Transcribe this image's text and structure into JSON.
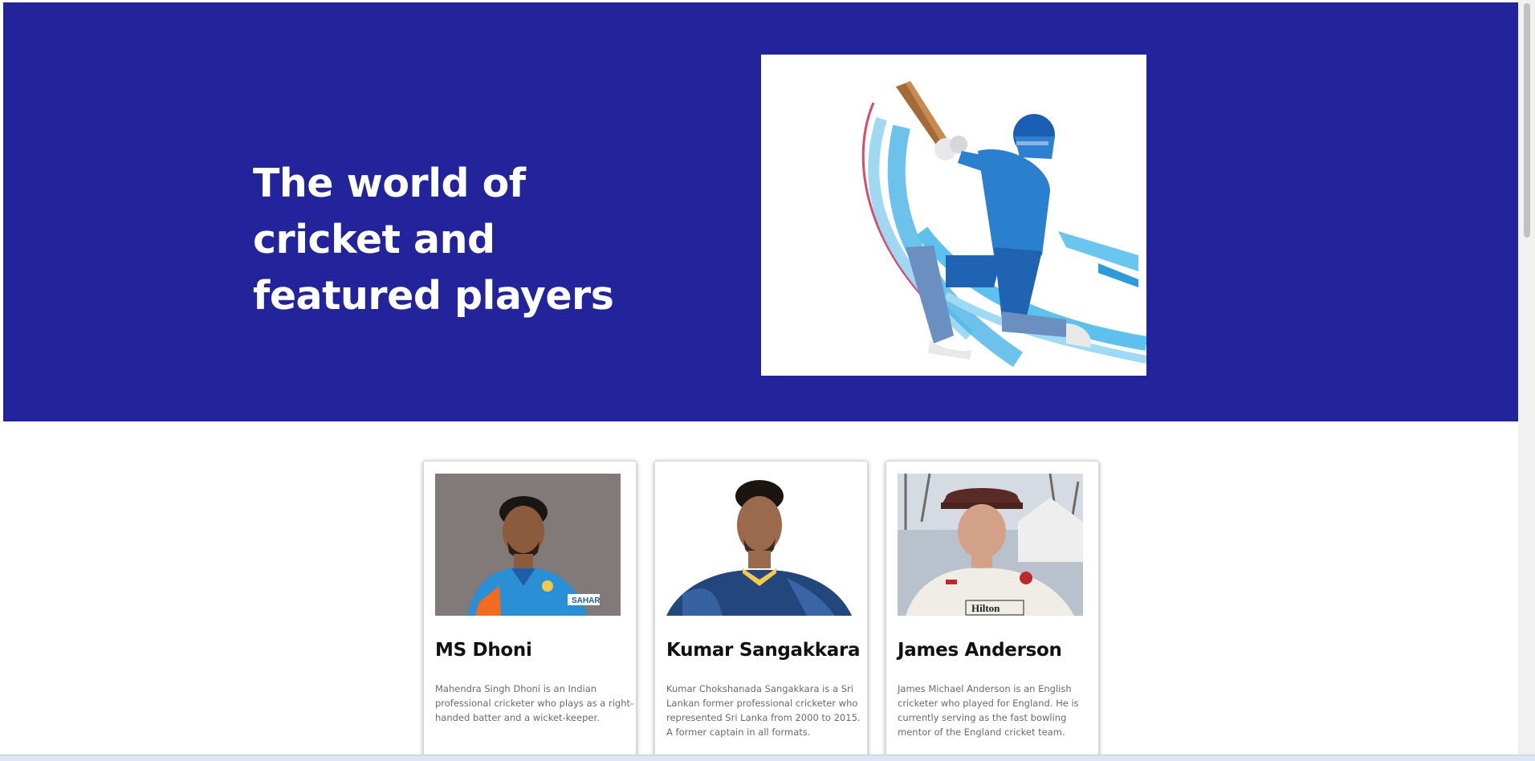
{
  "hero": {
    "title": "The world of cricket and featured players",
    "background_color": "#23239b",
    "image": "batsman-illustration"
  },
  "players": [
    {
      "name": "MS Dhoni",
      "description": "Mahendra Singh Dhoni is an Indian professional cricketer who plays as a right-handed batter and a wicket-keeper.",
      "photo": "ms-dhoni-photo"
    },
    {
      "name": "Kumar Sangakkara",
      "description": "Kumar Chokshanada Sangakkara is a Sri Lankan former professional cricketer who represented Sri Lanka from 2000 to 2015. A former captain in all formats.",
      "photo": "kumar-sangakkara-photo"
    },
    {
      "name": "James Anderson",
      "description": "James Michael Anderson is an English cricketer who played for England. He is currently serving as the fast bowling mentor of the England cricket team.",
      "photo": "james-anderson-photo"
    }
  ],
  "colors": {
    "hero_bg": "#23239b",
    "card_text": "#111111",
    "card_desc": "#6b6b6b"
  }
}
